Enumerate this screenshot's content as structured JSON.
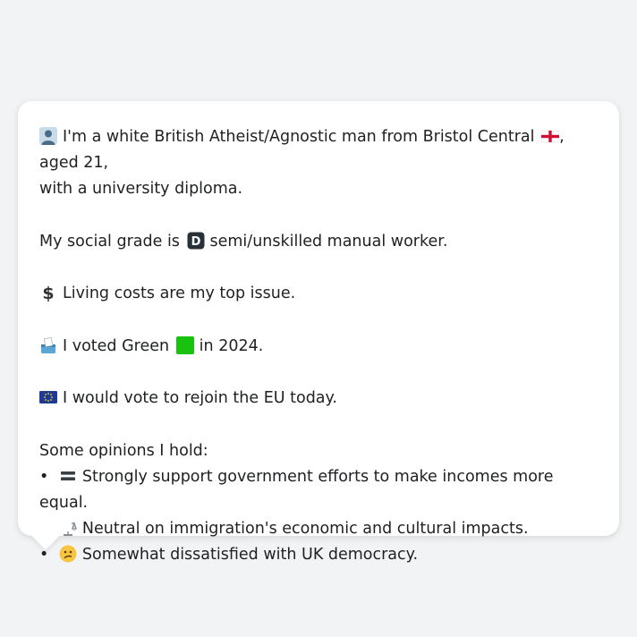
{
  "profile": {
    "line1_part1": "I'm a white British Atheist/Agnostic man from Bristol Central",
    "line1_part2": ", aged 21,",
    "line1_part3": "with a university diploma.",
    "grade_prefix": "My social grade is",
    "grade_letter": "D",
    "grade_suffix": "semi/unskilled manual worker.",
    "issue": "Living costs are my top issue.",
    "vote_prefix": "I voted Green",
    "vote_suffix": "in 2024.",
    "eu": "I would vote to rejoin the EU today.",
    "opinions_heading": "Some opinions I hold:",
    "opinions": [
      "Strongly support government efforts to make incomes more equal.",
      "Neutral on immigration's economic and cultural impacts.",
      "Somewhat dissatisfied with UK democracy."
    ]
  },
  "icons": {
    "person": "bust-in-silhouette-icon",
    "flag": "england-flag-icon",
    "grade": "letter-d-icon",
    "issue": "dollar-sign-icon",
    "ballot": "ballot-box-icon",
    "party": "green-square-icon",
    "eu": "eu-flag-icon",
    "equal": "equals-icon",
    "neutral": "balance-scale-icon",
    "dissatisfied": "confused-face-icon"
  },
  "colors": {
    "background": "#f2f3f5",
    "bubble": "#ffffff",
    "text": "#1e2022",
    "green": "#19c20f",
    "eu_blue": "#1f3a93"
  }
}
